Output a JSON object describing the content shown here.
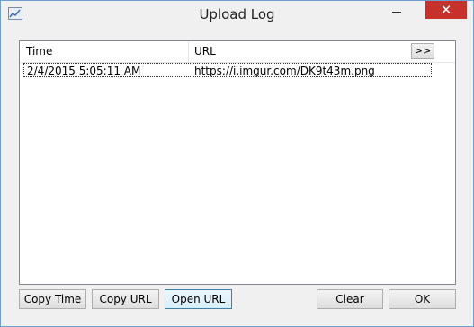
{
  "window": {
    "title": "Upload Log",
    "close_glyph": "✕",
    "icon": "chart-icon"
  },
  "list": {
    "columns": [
      "Time",
      "URL"
    ],
    "more_label": ">>",
    "rows": [
      {
        "time": "2/4/2015 5:05:11 AM",
        "url": "https://i.imgur.com/DK9t43m.png"
      }
    ]
  },
  "buttons": {
    "copy_time": "Copy Time",
    "copy_url": "Copy URL",
    "open_url": "Open URL",
    "clear": "Clear",
    "ok": "OK"
  },
  "colors": {
    "close_bg": "#c7312b",
    "border": "#6f9ed0"
  }
}
